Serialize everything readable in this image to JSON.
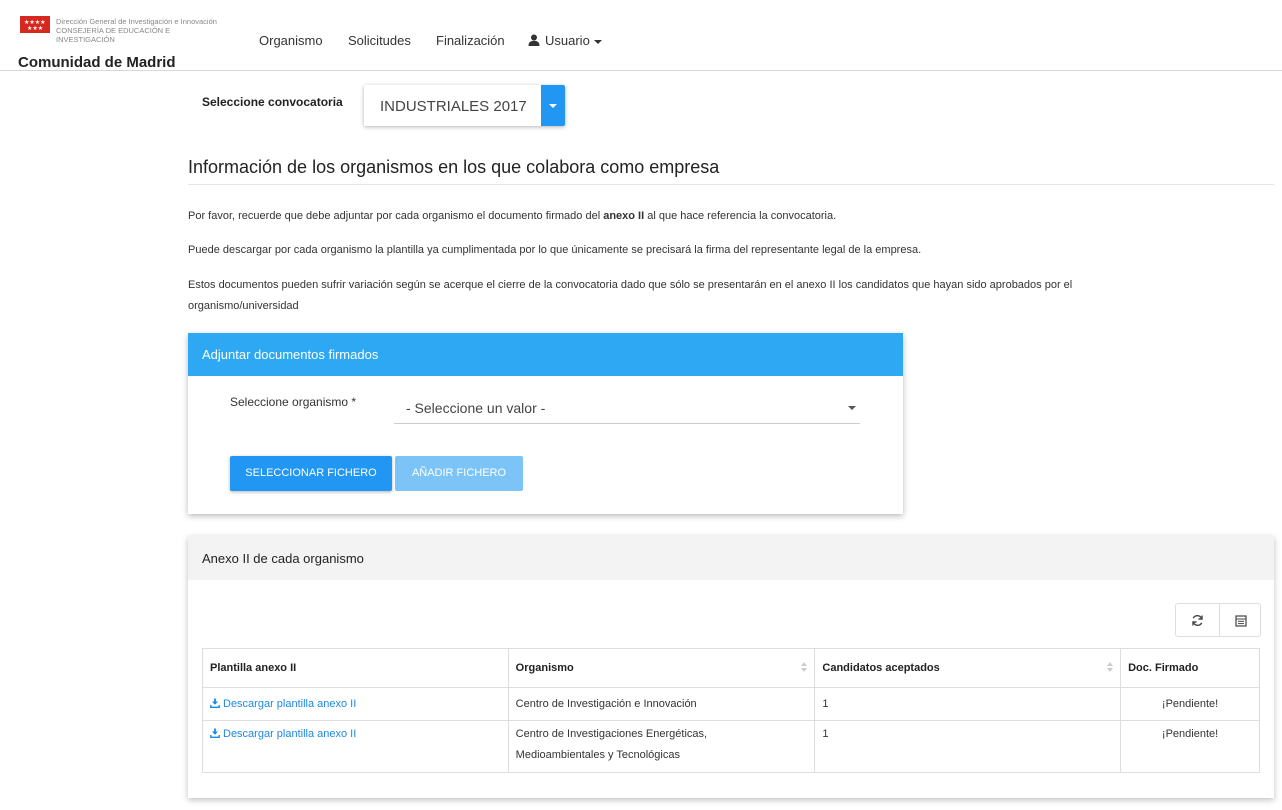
{
  "brand": {
    "line1": "Dirección General de Investigación e Innovación",
    "line2": "CONSEJERÍA DE EDUCACIÓN E",
    "line3": "INVESTIGACIÓN",
    "name": "Comunidad de Madrid",
    "flag_color": "#d6281e"
  },
  "nav": {
    "items": [
      "Organismo",
      "Solicitudes",
      "Finalización"
    ],
    "user_label": "Usuario",
    "user_icon": "user-icon"
  },
  "convocatoria": {
    "label": "Seleccione convocatoria",
    "value": "INDUSTRIALES 2017"
  },
  "page_title": "Información de los organismos en los que colabora como empresa",
  "paragraphs": {
    "p1_before": "Por favor, recuerde que debe adjuntar por cada organismo el documento firmado del ",
    "p1_bold": "anexo II",
    "p1_after": " al que hace referencia la convocatoria.",
    "p2": "Puede descargar por cada organismo la plantilla ya cumplimentada por lo que únicamente se precisará la firma del representante legal de la empresa.",
    "p3_line1": "Estos documentos pueden sufrir variación según se acerque el cierre de la convocatoria dado que sólo se presentarán en el anexo II los candidatos que hayan sido aprobados por el",
    "p3_line2": "organismo/universidad"
  },
  "attach_panel": {
    "title": "Adjuntar documentos firmados",
    "org_label": "Seleccione organismo *",
    "org_value": "- Seleccione un valor -",
    "select_file_button": "SELECCIONAR FICHERO",
    "add_file_button": "AÑADIR FICHERO",
    "accent_color": "#2ea8f2"
  },
  "annex_panel": {
    "title": "Anexo II de cada organismo",
    "toolbar_icons": [
      "refresh-icon",
      "columns-icon"
    ],
    "columns": [
      "Plantilla anexo II",
      "Organismo",
      "Candidatos aceptados",
      "Doc. Firmado"
    ],
    "rows": [
      {
        "template": "Descargar plantilla anexo II",
        "organismo_line1": "Centro de Investigación e Innovación",
        "organismo_line2": "",
        "candidatos": "1",
        "firmado": "¡Pendiente!"
      },
      {
        "template": "Descargar plantilla anexo II",
        "organismo_line1": "Centro de Investigaciones Energéticas,",
        "organismo_line2": "Medioambientales y Tecnológicas",
        "candidatos": "1",
        "firmado": "¡Pendiente!"
      }
    ]
  }
}
